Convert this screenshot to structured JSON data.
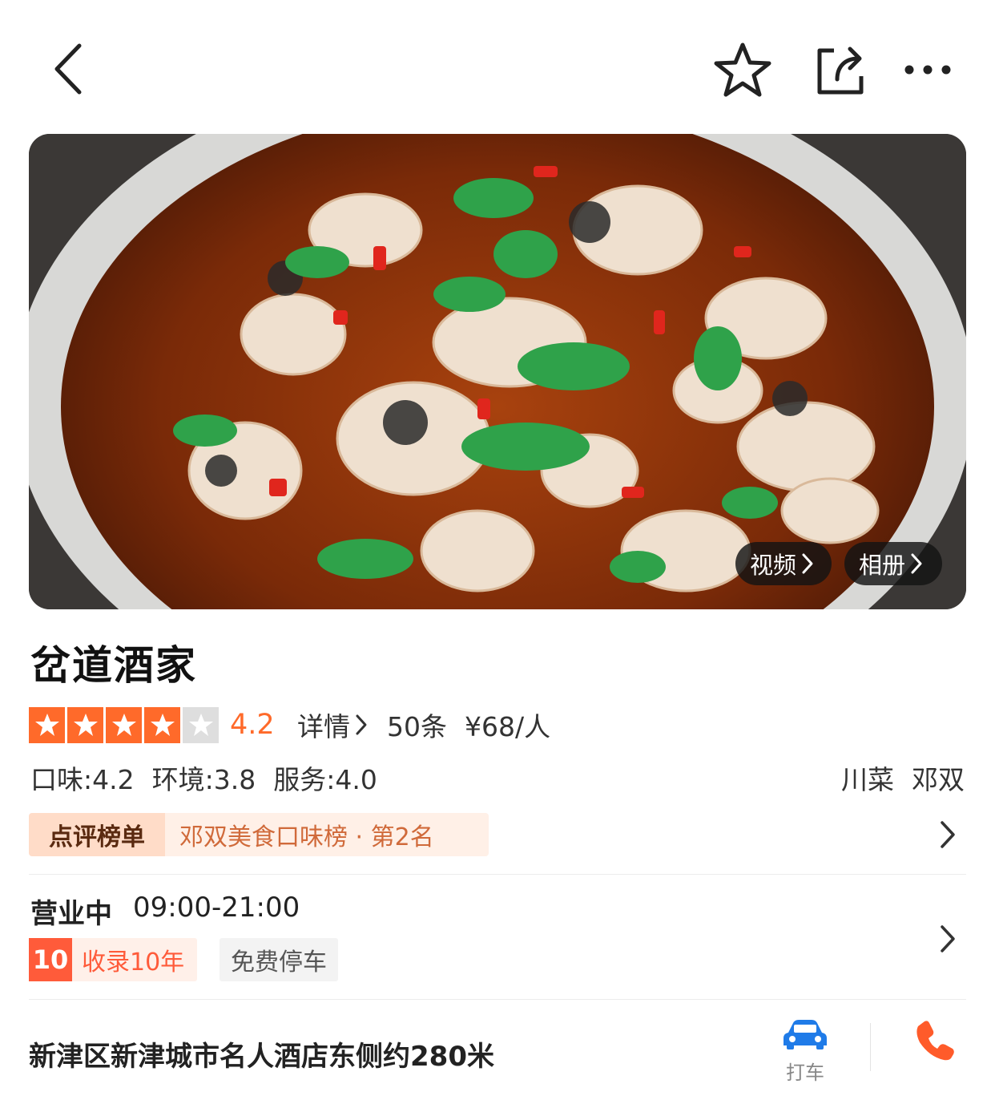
{
  "header": {
    "back_icon": "chevron-left-icon",
    "favorite_icon": "star-outline-icon",
    "share_icon": "share-icon",
    "more_icon": "more-dots-icon"
  },
  "hero": {
    "video_label": "视频",
    "album_label": "相册"
  },
  "shop": {
    "name": "岔道酒家",
    "rating": {
      "stars_filled": 4,
      "stars_total": 5,
      "score": "4.2",
      "detail_label": "详情",
      "review_count": "50条",
      "avg_price": "¥68/人"
    },
    "sub_scores": {
      "taste": "口味:4.2",
      "environment": "环境:3.8",
      "service": "服务:4.0"
    },
    "tags": {
      "cuisine": "川菜",
      "area": "邓双"
    },
    "rank": {
      "badge_label": "点评榜单",
      "text": "邓双美食口味榜 · 第2名"
    },
    "hours": {
      "status": "营业中",
      "time": "09:00-21:00"
    },
    "badges": {
      "years_number": "10",
      "years_text": "收录10年",
      "parking": "免费停车"
    },
    "address": "新津区新津城市名人酒店东侧约280米",
    "actions": {
      "taxi_label": "打车",
      "phone_icon": "phone-icon"
    }
  },
  "colors": {
    "accent": "#ff6a2a",
    "rank_badge_bg": "#ffdcc8",
    "rank_text": "#d06a3a",
    "years_red": "#ff5b3a",
    "taxi_blue": "#1f7be8"
  }
}
